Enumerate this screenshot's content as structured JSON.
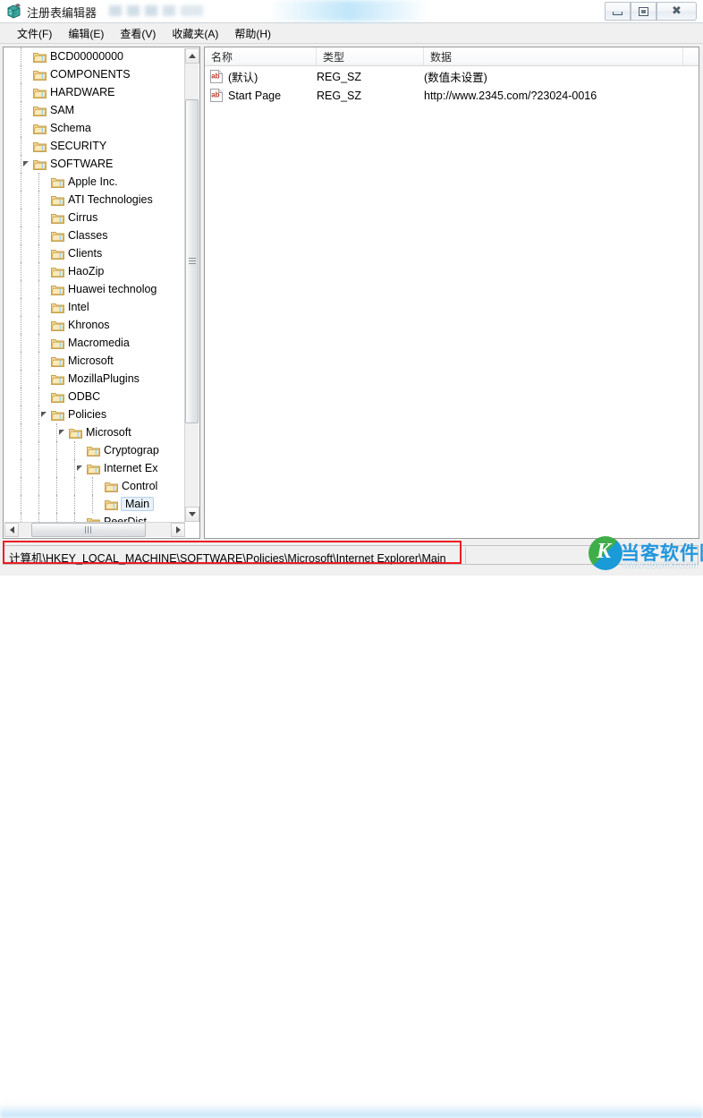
{
  "window": {
    "title": "注册表编辑器",
    "app_icon": "registry-editor-icon",
    "controls": {
      "minimize": "最小化",
      "maximize": "最大化",
      "close": "关闭"
    }
  },
  "menubar": {
    "items": [
      {
        "label": "文件(F)"
      },
      {
        "label": "编辑(E)"
      },
      {
        "label": "查看(V)"
      },
      {
        "label": "收藏夹(A)"
      },
      {
        "label": "帮助(H)"
      }
    ]
  },
  "tree": {
    "nodes": [
      {
        "label": "BCD00000000",
        "depth": 1,
        "state": "collapsed"
      },
      {
        "label": "COMPONENTS",
        "depth": 1,
        "state": "collapsed"
      },
      {
        "label": "HARDWARE",
        "depth": 1,
        "state": "collapsed"
      },
      {
        "label": "SAM",
        "depth": 1,
        "state": "collapsed"
      },
      {
        "label": "Schema",
        "depth": 1,
        "state": "collapsed"
      },
      {
        "label": "SECURITY",
        "depth": 1,
        "state": "leaf"
      },
      {
        "label": "SOFTWARE",
        "depth": 1,
        "state": "expanded"
      },
      {
        "label": "Apple Inc.",
        "depth": 2,
        "state": "collapsed"
      },
      {
        "label": "ATI Technologies",
        "depth": 2,
        "state": "collapsed"
      },
      {
        "label": "Cirrus",
        "depth": 2,
        "state": "collapsed"
      },
      {
        "label": "Classes",
        "depth": 2,
        "state": "collapsed"
      },
      {
        "label": "Clients",
        "depth": 2,
        "state": "collapsed"
      },
      {
        "label": "HaoZip",
        "depth": 2,
        "state": "leaf"
      },
      {
        "label": "Huawei technolog",
        "depth": 2,
        "state": "collapsed"
      },
      {
        "label": "Intel",
        "depth": 2,
        "state": "collapsed"
      },
      {
        "label": "Khronos",
        "depth": 2,
        "state": "collapsed"
      },
      {
        "label": "Macromedia",
        "depth": 2,
        "state": "collapsed"
      },
      {
        "label": "Microsoft",
        "depth": 2,
        "state": "collapsed"
      },
      {
        "label": "MozillaPlugins",
        "depth": 2,
        "state": "collapsed"
      },
      {
        "label": "ODBC",
        "depth": 2,
        "state": "collapsed"
      },
      {
        "label": "Policies",
        "depth": 2,
        "state": "expanded"
      },
      {
        "label": "Microsoft",
        "depth": 3,
        "state": "expanded"
      },
      {
        "label": "Cryptograp",
        "depth": 4,
        "state": "collapsed"
      },
      {
        "label": "Internet Ex",
        "depth": 4,
        "state": "expanded"
      },
      {
        "label": "Control",
        "depth": 5,
        "state": "leaf"
      },
      {
        "label": "Main",
        "depth": 5,
        "state": "leaf",
        "selected": true
      },
      {
        "label": "PeerDist",
        "depth": 4,
        "state": "leaf"
      }
    ]
  },
  "list": {
    "columns": [
      {
        "label": "名称"
      },
      {
        "label": "类型"
      },
      {
        "label": "数据"
      }
    ],
    "rows": [
      {
        "name": "(默认)",
        "type": "REG_SZ",
        "data": "(数值未设置)",
        "icon": "string-value-icon"
      },
      {
        "name": "Start Page",
        "type": "REG_SZ",
        "data": "http://www.2345.com/?23024-0016",
        "icon": "string-value-icon"
      }
    ]
  },
  "statusbar": {
    "path": "计算机\\HKEY_LOCAL_MACHINE\\SOFTWARE\\Policies\\Microsoft\\Internet Explorer\\Main",
    "highlight_color": "#ee1b24"
  },
  "watermark": {
    "monogram": "K",
    "brand": "当客软件园",
    "url": "www.downkr.com"
  }
}
